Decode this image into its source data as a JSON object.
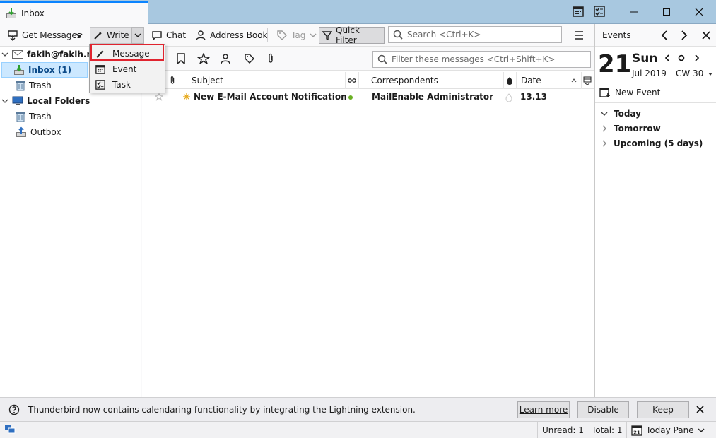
{
  "tab": {
    "title": "Inbox"
  },
  "toolbar": {
    "get_messages": "Get Messages",
    "write": "Write",
    "chat": "Chat",
    "address_book": "Address Book",
    "tag": "Tag",
    "quick_filter": "Quick Filter",
    "search_placeholder": "Search <Ctrl+K>"
  },
  "write_menu": {
    "items": [
      {
        "label": "Message",
        "icon": "pencil-icon"
      },
      {
        "label": "Event",
        "icon": "calendar-icon"
      },
      {
        "label": "Task",
        "icon": "task-icon"
      }
    ]
  },
  "folders": {
    "account": "fakih@fakih.net",
    "inbox": "Inbox (1)",
    "trash": "Trash",
    "local_folders": "Local Folders",
    "local_trash": "Trash",
    "outbox": "Outbox"
  },
  "filter": {
    "placeholder": "Filter these messages <Ctrl+Shift+K>"
  },
  "columns": {
    "subject": "Subject",
    "correspondents": "Correspondents",
    "date": "Date"
  },
  "messages": [
    {
      "subject": "New E-Mail Account Notification",
      "correspondent": "MailEnable Administrator",
      "date": "13.13"
    }
  ],
  "today_pane": {
    "events_label": "Events",
    "day_number": "21",
    "weekday": "Sun",
    "month_year": "Jul 2019",
    "week": "CW 30",
    "new_event": "New Event",
    "sections": [
      "Today",
      "Tomorrow",
      "Upcoming (5 days)"
    ]
  },
  "notification": {
    "text": "Thunderbird now contains calendaring functionality by integrating the Lightning extension.",
    "learn_more": "Learn more",
    "disable": "Disable",
    "keep": "Keep"
  },
  "status": {
    "unread": "Unread: 1",
    "total": "Total: 1",
    "today_pane": "Today Pane"
  },
  "colors": {
    "accent": "#0a84ff",
    "title_bar": "#a8c8e0",
    "selection": "#cce8ff",
    "highlight_box": "#e0232e",
    "unread_dot": "#6ab023"
  }
}
